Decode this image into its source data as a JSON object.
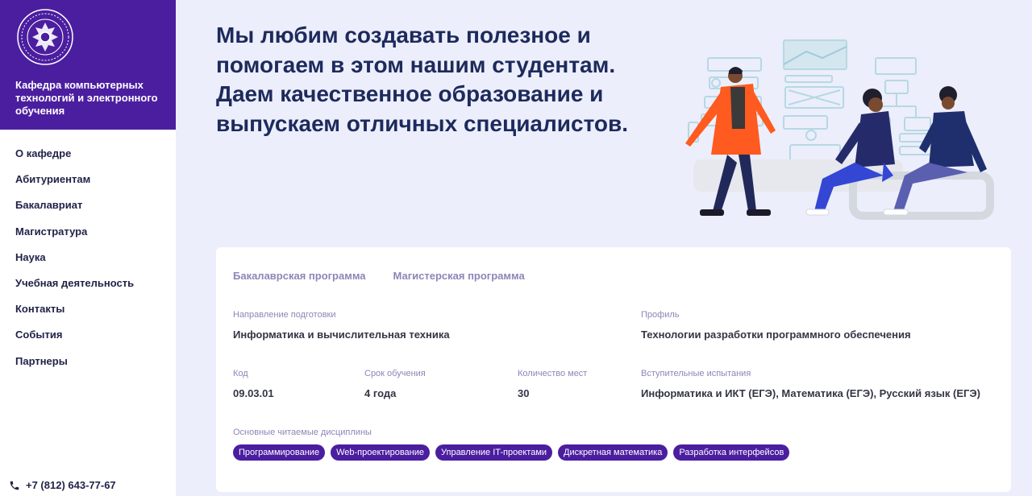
{
  "brand": {
    "logo_icon": "coat-of-arms-logo",
    "title": "Кафедра компьютерных технологий и электронного обучения"
  },
  "nav": {
    "items": [
      {
        "label": "О кафедре"
      },
      {
        "label": "Абитуриентам"
      },
      {
        "label": "Бакалавриат"
      },
      {
        "label": "Магистратура"
      },
      {
        "label": "Наука"
      },
      {
        "label": "Учебная деятельность"
      },
      {
        "label": "Контакты"
      },
      {
        "label": "События"
      },
      {
        "label": "Партнеры"
      }
    ]
  },
  "contact": {
    "phone_icon": "phone-icon",
    "phone": "+7 (812) 643-77-67"
  },
  "hero": {
    "line1": "Мы любим создавать полезное и",
    "line2": "помогаем в этом нашим студентам.",
    "line3": "Даем качественное образование и",
    "line4": "выпускаем отличных специалистов."
  },
  "program": {
    "tabs": [
      {
        "label": "Бакалаврская программа"
      },
      {
        "label": "Магистерская программа"
      }
    ],
    "direction": {
      "label": "Направление подготовки",
      "value": "Информатика и вычислительная техника"
    },
    "profile": {
      "label": "Профиль",
      "value": "Технологии разработки программного обеспечения"
    },
    "code": {
      "label": "Код",
      "value": "09.03.01"
    },
    "duration": {
      "label": "Срок обучения",
      "value": "4 года"
    },
    "places": {
      "label": "Количество мест",
      "value": "30"
    },
    "exams": {
      "label": "Вступительные испытания",
      "value": "Информатика и ИКТ (ЕГЭ), Математика (ЕГЭ), Русский язык (ЕГЭ)"
    },
    "disciplines": {
      "label": "Основные читаемые дисциплины",
      "items": [
        "Программирование",
        "Web-проектирование",
        "Управление IT-проектами",
        "Дискретная математика",
        "Разработка интерфейсов"
      ]
    }
  },
  "colors": {
    "brand_purple": "#4b1ea0",
    "page_bg": "#eceefb",
    "heading": "#1d2a5c",
    "muted_label": "#8c86b8"
  }
}
